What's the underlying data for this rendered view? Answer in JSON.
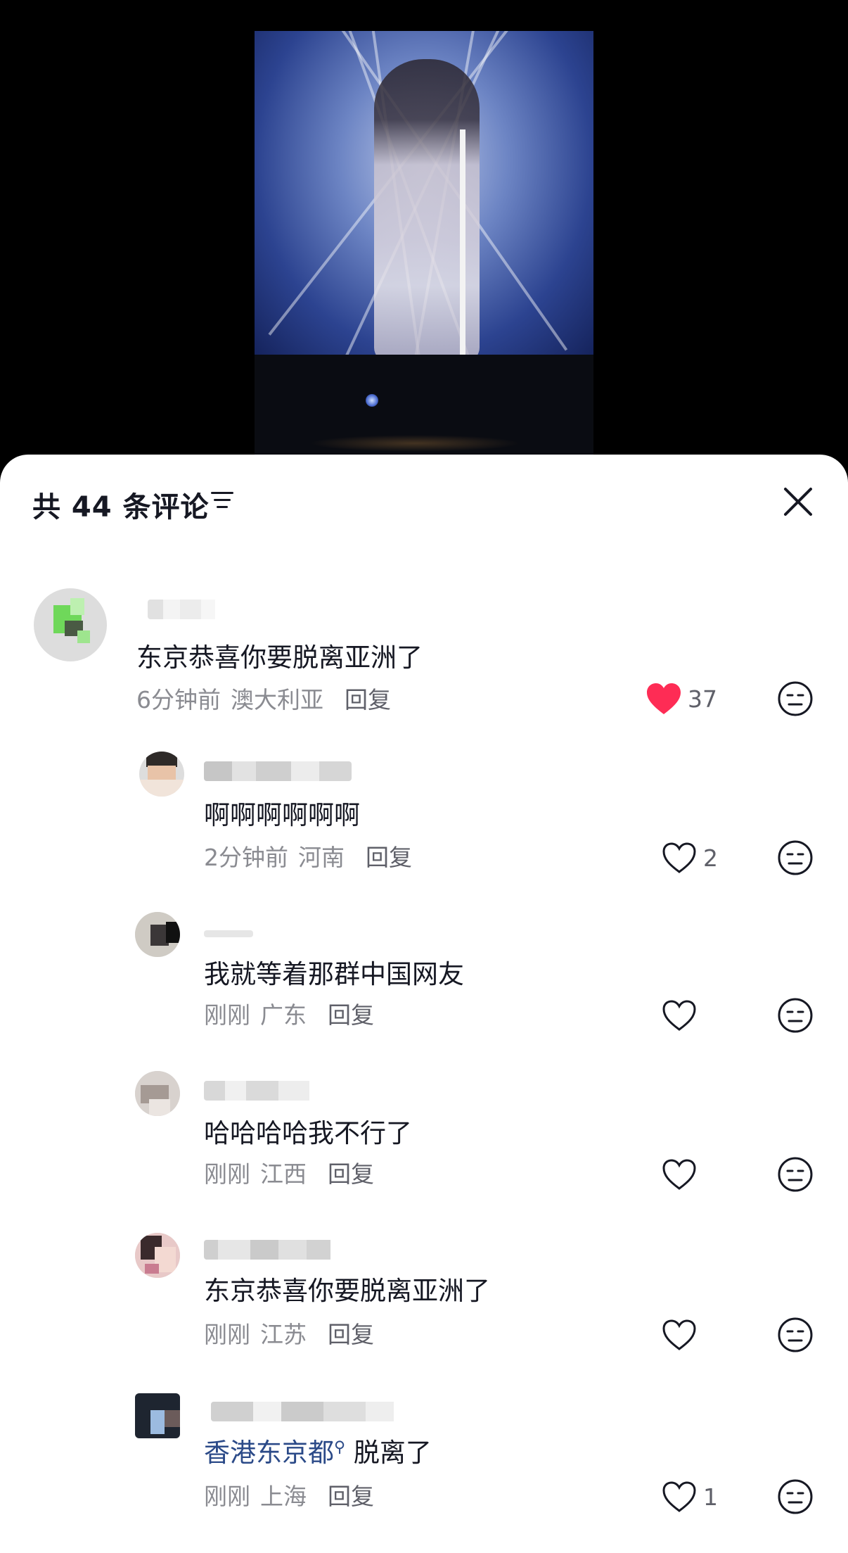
{
  "header": {
    "count_title": "共 44 条评论"
  },
  "comments": [
    {
      "text": "东京恭喜你要脱离亚洲了",
      "time": "6分钟前",
      "location": "澳大利亚",
      "reply_label": "回复",
      "likes": "37",
      "liked": true
    },
    {
      "text": "啊啊啊啊啊啊",
      "time": "2分钟前",
      "location": "河南",
      "reply_label": "回复",
      "likes": "2",
      "liked": false
    },
    {
      "text": "我就等着那群中国网友",
      "time": "刚刚",
      "location": "广东",
      "reply_label": "回复",
      "likes": "",
      "liked": false
    },
    {
      "text": "哈哈哈哈我不行了",
      "time": "刚刚",
      "location": "江西",
      "reply_label": "回复",
      "likes": "",
      "liked": false
    },
    {
      "text": "东京恭喜你要脱离亚洲了",
      "time": "刚刚",
      "location": "江苏",
      "reply_label": "回复",
      "likes": "",
      "liked": false
    },
    {
      "mention": "香港东京都",
      "text": " 脱离了",
      "time": "刚刚",
      "location": "上海",
      "reply_label": "回复",
      "likes": "1",
      "liked": false
    }
  ],
  "colors": {
    "liked_heart": "#fe2c55",
    "mention": "#2b4a88",
    "meta": "#8a8b91"
  }
}
